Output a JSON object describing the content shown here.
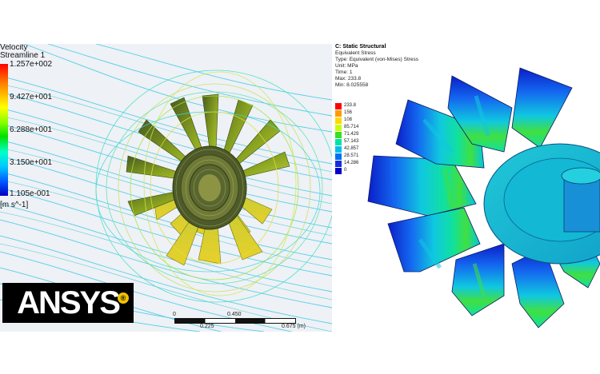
{
  "cfd": {
    "legend": {
      "title_line1": "Velocity",
      "title_line2": "Streamline 1",
      "values": [
        "1.257e+002",
        "9.427e+001",
        "6.288e+001",
        "3.150e+001",
        "1.105e-001"
      ],
      "unit": "[m s^-1]"
    },
    "scale": {
      "labels": [
        "0",
        "0.450",
        "0.225",
        "0.675 (m)"
      ]
    }
  },
  "logo": {
    "text": "ANSYS",
    "mark": "®"
  },
  "structural": {
    "title": "C: Static Structural",
    "lines": [
      "Equivalent Stress",
      "Type: Equivalent (von-Mises) Stress",
      "Unit: MPa",
      "Time: 1",
      "Max: 233.8",
      "Min: 8.025558"
    ],
    "legend": [
      {
        "label": "233.8",
        "color": "#ff0000"
      },
      {
        "label": "156",
        "color": "#ff9a00"
      },
      {
        "label": "108",
        "color": "#ffd800"
      },
      {
        "label": "85.714",
        "color": "#c8ff00"
      },
      {
        "label": "71.429",
        "color": "#38e020"
      },
      {
        "label": "57.143",
        "color": "#00e2a8"
      },
      {
        "label": "42.857",
        "color": "#00c0e8"
      },
      {
        "label": "28.571",
        "color": "#0070f0"
      },
      {
        "label": "14.286",
        "color": "#1030e0"
      },
      {
        "label": "0",
        "color": "#0000c8"
      }
    ]
  }
}
